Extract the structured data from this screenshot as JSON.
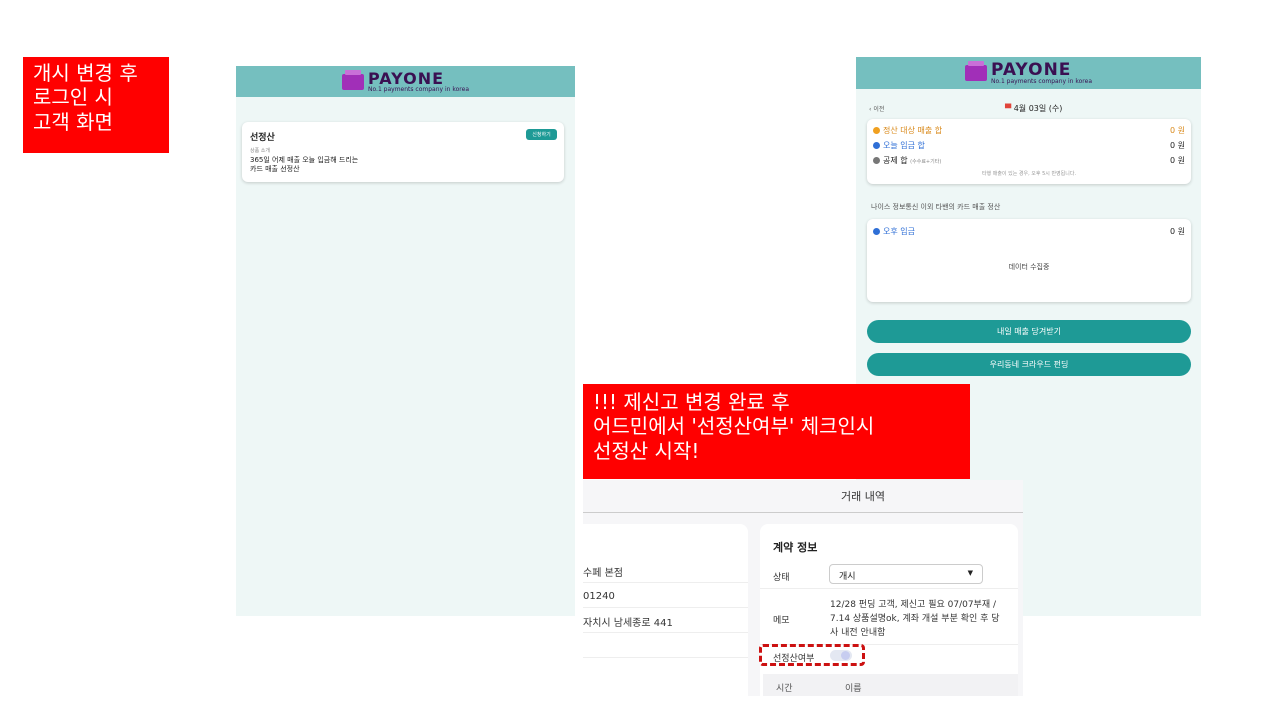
{
  "labels": {
    "login_note": "개시 변경 후\n로그인 시\n고객 화면",
    "admin_note": "!!! 제신고 변경 완료 후\n어드민에서 '선정산여부' 체크인시\n선정산 시작!"
  },
  "brand": {
    "name": "PAYONE",
    "tagline": "No.1 payments company in korea",
    "badge_text": "PAYONE"
  },
  "left_screen": {
    "card_title": "선정산",
    "apply_button": "신청하기",
    "intro_label": "상품 소개",
    "intro_line1": "365일 어제 매출 오늘 입금해 드리는",
    "intro_line2": "카드 매출 선정산"
  },
  "right_screen": {
    "back_label": "이전",
    "date": "4월 03일 (수)",
    "summary_rows": [
      {
        "label": "정산 대상 매출 합",
        "value": "0 원"
      },
      {
        "label": "오늘 입금 합",
        "value": "0 원"
      },
      {
        "label": "공제 합",
        "sub": "(수수료+기타)",
        "value": "0 원"
      }
    ],
    "summary_note": "타행 매출이 있는 경우, 오후 5시 반영됩니다.",
    "section_caption": "나이스 정보통신 이외 타밴의 카드 매출 정산",
    "afternoon_label": "오후 입금",
    "afternoon_value": "0 원",
    "collecting": "데이터 수집중",
    "button1": "내일 매출 당겨받기",
    "button2": "우리동네 크라우드 펀딩"
  },
  "admin": {
    "header_title": "거래 내역",
    "left_rows": [
      "수페 본점",
      "01240",
      "자치시 남세종로 441"
    ],
    "section_title": "계약 정보",
    "status_label": "상태",
    "status_value": "개시",
    "memo_label": "메모",
    "memo_text": "12/28 펀딩 고객, 제신고 필요 07/07부재 / 7.14 상품설명ok, 계좌 개설 부분 확인 후 당사 내전 안내함",
    "presettle_label": "선정산여부",
    "table_headers": [
      "시간",
      "이름"
    ]
  },
  "colors": {
    "teal_header": "#75bfbf",
    "teal_button": "#1e9a96",
    "red": "#ff0000",
    "orange": "#f0a020",
    "blue": "#2f6fd6"
  }
}
